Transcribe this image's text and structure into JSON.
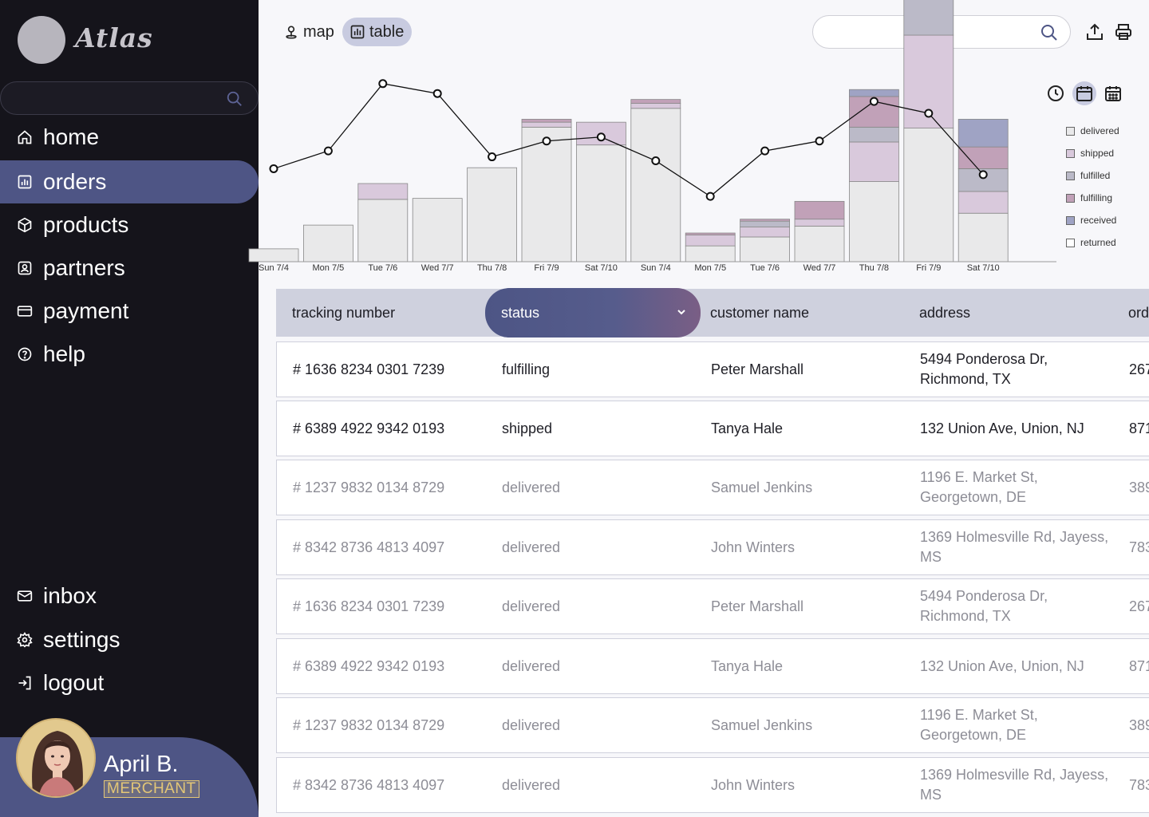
{
  "app": {
    "logo_text": "Atlas"
  },
  "sidebar": {
    "search_placeholder": "",
    "items": [
      {
        "label": "home",
        "icon": "home-icon"
      },
      {
        "label": "orders",
        "icon": "chart-icon",
        "active": true
      },
      {
        "label": "products",
        "icon": "box-icon"
      },
      {
        "label": "partners",
        "icon": "partner-icon"
      },
      {
        "label": "payment",
        "icon": "card-icon"
      },
      {
        "label": "help",
        "icon": "help-icon"
      }
    ],
    "bottom_items": [
      {
        "label": "inbox",
        "icon": "mail-icon"
      },
      {
        "label": "settings",
        "icon": "gear-icon"
      },
      {
        "label": "logout",
        "icon": "logout-icon"
      }
    ],
    "profile": {
      "name": "April B.",
      "role": "MERCHANT"
    }
  },
  "topbar": {
    "views": [
      {
        "label": "map",
        "icon": "map-pin-icon"
      },
      {
        "label": "table",
        "icon": "chart-icon",
        "active": true
      }
    ],
    "search_placeholder": ""
  },
  "chart_data": {
    "type": "bar",
    "categories": [
      "Sun 7/4",
      "Mon 7/5",
      "Tue 7/6",
      "Wed 7/7",
      "Thu 7/8",
      "Fri 7/9",
      "Sat 7/10",
      "Sun 7/4",
      "Mon 7/5",
      "Tue 7/6",
      "Wed 7/7",
      "Thu 7/8",
      "Fri 7/9",
      "Sat 7/10"
    ],
    "ylim": [
      0,
      100
    ],
    "stacked": true,
    "legend_position": "right",
    "series": [
      {
        "name": "delivered",
        "color": "#e9e9ea",
        "values": [
          6.5,
          18.5,
          31.5,
          32,
          47.5,
          68,
          59,
          77.5,
          8,
          12.5,
          18,
          40.5,
          67.5,
          24.5
        ]
      },
      {
        "name": "shipped",
        "color": "#d9c9dc",
        "values": [
          0,
          0,
          8,
          0,
          0,
          2.5,
          11.5,
          2.5,
          5.5,
          5,
          3.5,
          20,
          47,
          11
        ]
      },
      {
        "name": "fulfilled",
        "color": "#bbbac8",
        "values": [
          0,
          0,
          0,
          0,
          0,
          0,
          0,
          0,
          0,
          3,
          0,
          7.5,
          18.5,
          11.5
        ]
      },
      {
        "name": "fulfilling",
        "color": "#c1a1b8",
        "values": [
          0,
          0,
          0,
          0,
          0,
          1.5,
          0,
          2,
          1,
          1,
          9,
          15.5,
          12,
          11
        ]
      },
      {
        "name": "received",
        "color": "#9fa3c4",
        "values": [
          0,
          0,
          0,
          0,
          0,
          0,
          0,
          0,
          0,
          0,
          0,
          3.5,
          3.5,
          14
        ]
      },
      {
        "name": "returned",
        "color": "#ffffff",
        "values": [
          0,
          0,
          0,
          0,
          0,
          0,
          0,
          0,
          0,
          0,
          0,
          0,
          0,
          0
        ]
      }
    ],
    "line": {
      "values": [
        47,
        56,
        90,
        85,
        53,
        61,
        63,
        51,
        33,
        56,
        61,
        81,
        75,
        44
      ]
    }
  },
  "time_controls": [
    {
      "icon": "clock-icon"
    },
    {
      "icon": "calendar-icon",
      "active": true
    },
    {
      "icon": "calendar-grid-icon"
    }
  ],
  "table": {
    "columns": [
      "tracking number",
      "status",
      "customer name",
      "address",
      "ord"
    ],
    "rows": [
      {
        "tracking": "# 1636 8234 0301 7239",
        "status": "fulfilling",
        "customer": "Peter Marshall",
        "address_line1": "5494 Ponderosa Dr,",
        "address_line2": "Richmond, TX",
        "order": "267",
        "muted": false
      },
      {
        "tracking": "# 6389 4922 9342 0193",
        "status": "shipped",
        "customer": "Tanya Hale",
        "address_line1": "132 Union Ave, Union, NJ",
        "address_line2": "",
        "order": "871",
        "muted": false
      },
      {
        "tracking": "# 1237 9832 0134 8729",
        "status": "delivered",
        "customer": "Samuel Jenkins",
        "address_line1": "1196 E. Market St,",
        "address_line2": "Georgetown, DE",
        "order": "389",
        "muted": true
      },
      {
        "tracking": "# 8342 8736 4813 4097",
        "status": "delivered",
        "customer": "John Winters",
        "address_line1": "1369 Holmesville Rd, Jayess,",
        "address_line2": "MS",
        "order": "783",
        "muted": true
      },
      {
        "tracking": "# 1636 8234 0301 7239",
        "status": "delivered",
        "customer": "Peter Marshall",
        "address_line1": "5494 Ponderosa Dr,",
        "address_line2": "Richmond, TX",
        "order": "267",
        "muted": true
      },
      {
        "tracking": "# 6389 4922 9342 0193",
        "status": "delivered",
        "customer": "Tanya Hale",
        "address_line1": "132 Union Ave, Union, NJ",
        "address_line2": "",
        "order": "871",
        "muted": true
      },
      {
        "tracking": "# 1237 9832 0134 8729",
        "status": "delivered",
        "customer": "Samuel Jenkins",
        "address_line1": "1196 E. Market St,",
        "address_line2": "Georgetown, DE",
        "order": "389",
        "muted": true
      },
      {
        "tracking": "# 8342 8736 4813 4097",
        "status": "delivered",
        "customer": "John Winters",
        "address_line1": "1369 Holmesville Rd, Jayess,",
        "address_line2": "MS",
        "order": "783",
        "muted": true
      }
    ]
  }
}
